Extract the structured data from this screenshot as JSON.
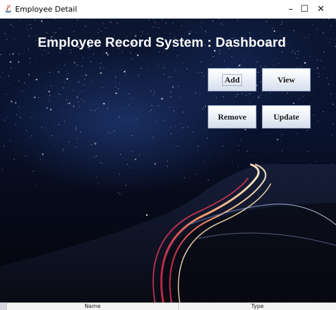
{
  "window": {
    "title": "Employee Detail",
    "controls": {
      "minimize": "–",
      "maximize": "☐",
      "close": "✕"
    },
    "icon": "java-app-icon"
  },
  "dashboard": {
    "heading": "Employee Record System : Dashboard",
    "buttons": {
      "add": "Add",
      "view": "View",
      "remove": "Remove",
      "update": "Update"
    }
  },
  "table_header": {
    "columns": [
      "Name",
      "Type"
    ]
  },
  "colors": {
    "sky": "#0a1431",
    "button_border": "#8ea2c0",
    "light_trail": "#ffd9a0"
  }
}
